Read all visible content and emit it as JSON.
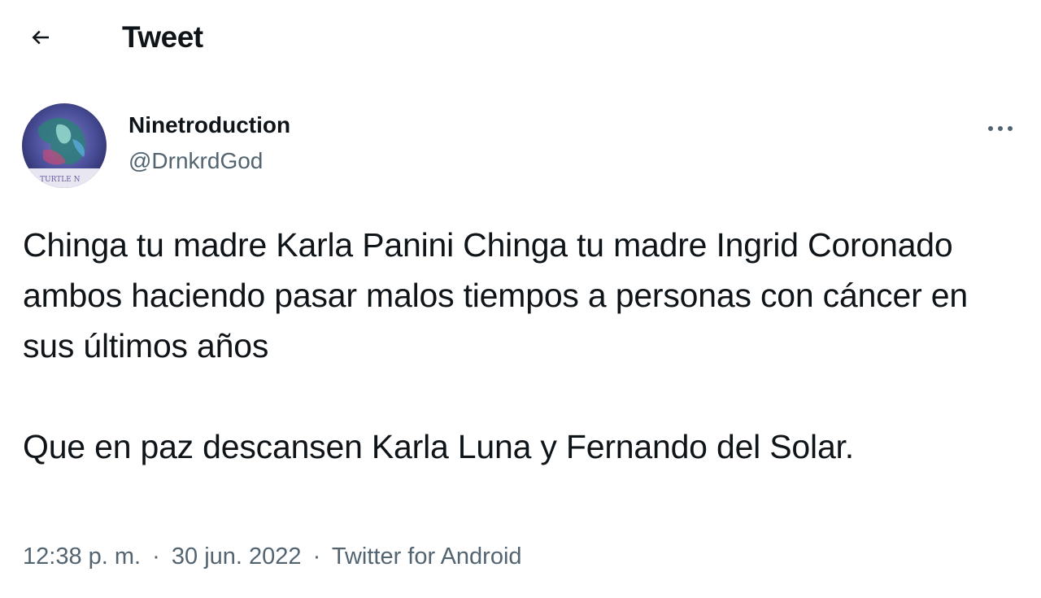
{
  "header": {
    "back_icon": "arrow-left-icon",
    "title": "Tweet"
  },
  "tweet": {
    "author": {
      "display_name": "Ninetroduction",
      "handle": "@DrnkrdGod",
      "avatar_caption": "TURTLE N"
    },
    "more_icon": "more-horizontal-icon",
    "paragraphs": [
      "Chinga tu madre Karla Panini Chinga tu madre Ingrid Coronado ambos haciendo pasar malos tiempos a personas con cáncer en sus últimos años",
      "Que en paz descansen Karla Luna y Fernando del Solar."
    ],
    "meta": {
      "time": "12:38 p. m.",
      "separator": "·",
      "date": "30 jun. 2022",
      "source": "Twitter for Android"
    }
  },
  "colors": {
    "text": "#0f1419",
    "secondary_text": "#536471",
    "background": "#ffffff"
  }
}
